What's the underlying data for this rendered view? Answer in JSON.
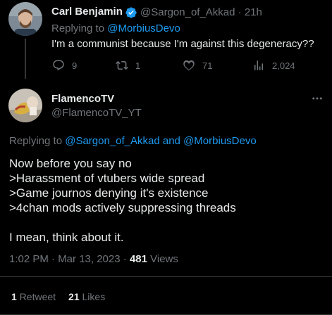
{
  "parent_tweet": {
    "author_name": "Carl Benjamin",
    "handle": "@Sargon_of_Akkad",
    "time": "21h",
    "replying_prefix": "Replying to ",
    "replying_to": "@MorbiusDevo",
    "text": "I'm a communist because I'm against this degeneracy??",
    "replies": "9",
    "retweets": "1",
    "likes": "71",
    "views": "2,024"
  },
  "main_tweet": {
    "author_name": "FlamencoTV",
    "handle": "@FlamencoTV_YT",
    "replying_prefix": "Replying to ",
    "replying_to_1": "@Sargon_of_Akkad",
    "replying_joiner": " and ",
    "replying_to_2": "@MorbiusDevo",
    "body_lines": [
      "Now before you say no",
      ">Harassment of vtubers wide spread",
      ">Game journos denying it's existence",
      ">4chan mods actively suppressing threads"
    ],
    "body_closing": "I mean, think about it.",
    "timestamp": "1:02 PM · Mar 13, 2023",
    "meta_sep": " · ",
    "views_count": "481",
    "views_label": " Views",
    "retweets_count": "1",
    "retweets_label": " Retweet",
    "likes_count": "21",
    "likes_label": " Likes"
  },
  "colors": {
    "background": "#000000",
    "text": "#e7e9ea",
    "muted": "#71767b",
    "link": "#1d9bf0",
    "divider": "#2f3336"
  },
  "icons": [
    "verified-badge-icon",
    "reply-icon",
    "retweet-icon",
    "like-icon",
    "views-icon",
    "more-icon"
  ]
}
